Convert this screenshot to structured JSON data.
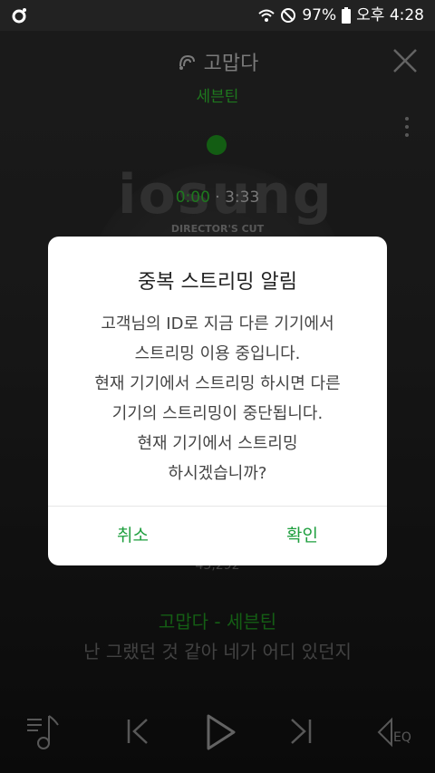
{
  "status": {
    "battery": "97%",
    "time": "오후 4:28"
  },
  "player": {
    "song_title": "고맙다",
    "artist": "세븐틴",
    "album_text": "iosung",
    "time_current": "0:00",
    "time_separator": "·",
    "time_total": "3:33",
    "album_edition": "DIRECTOR'S CUT",
    "play_count": "43,292",
    "lyric_title": "고맙다 - 세븐틴",
    "lyric_line": "난 그랬던 것 같아 네가 어디 있던지"
  },
  "dialog": {
    "title": "중복 스트리밍 알림",
    "lines": [
      "고객님의 ID로 지금 다른 기기에서",
      "스트리밍 이용 중입니다.",
      "현재 기기에서 스트리밍 하시면 다른",
      "기기의 스트리밍이 중단됩니다.",
      "현재 기기에서 스트리밍",
      "하시겠습니까?"
    ],
    "cancel_label": "취소",
    "confirm_label": "확인"
  },
  "icons": {
    "app": "app-icon",
    "wifi": "wifi-icon",
    "dnd": "do-not-disturb-icon",
    "battery": "battery-icon",
    "close": "close-icon",
    "more": "more-vertical-icon",
    "playlist": "playlist-icon",
    "prev": "previous-icon",
    "play": "play-icon",
    "next": "next-icon",
    "eq": "equalizer-icon"
  },
  "colors": {
    "accent": "#2eb82e",
    "dialog_button": "#1f9f3f"
  }
}
